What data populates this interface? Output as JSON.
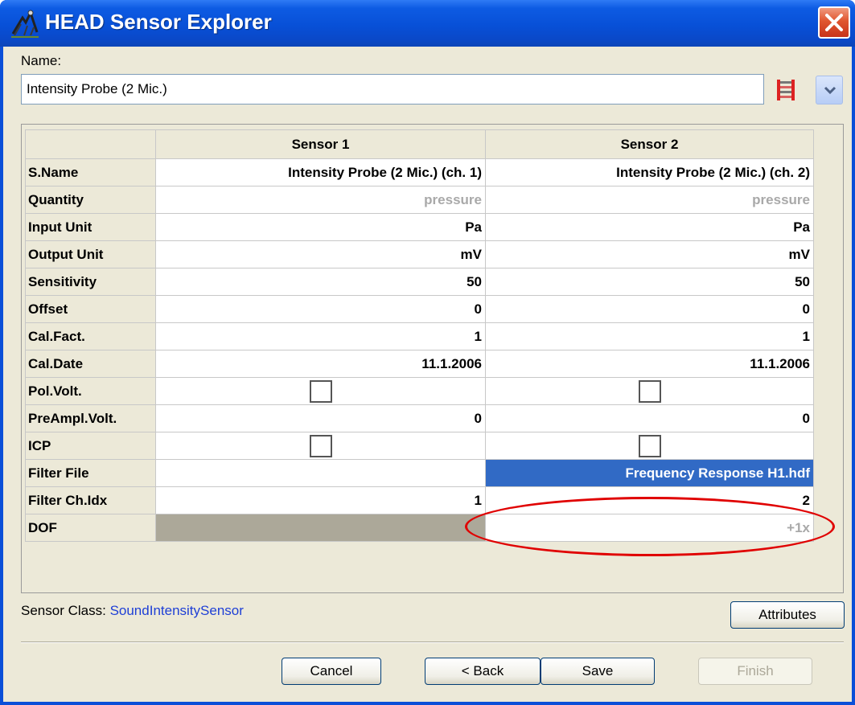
{
  "window": {
    "title": "HEAD Sensor Explorer",
    "app_icon": "head-explorer-icon",
    "close_icon": "close-icon"
  },
  "name_field": {
    "label": "Name:",
    "value": "Intensity Probe (2 Mic.)",
    "list_icon": "sensor-list-icon",
    "dropdown_icon": "chevron-down-icon"
  },
  "grid": {
    "columns": [
      "Sensor 1",
      "Sensor 2"
    ],
    "rows": [
      {
        "label": "S.Name",
        "s1": "Intensity Probe (2 Mic.) (ch. 1)",
        "s2": "Intensity Probe (2 Mic.) (ch. 2)"
      },
      {
        "label": "Quantity",
        "s1": "pressure",
        "s2": "pressure"
      },
      {
        "label": "Input Unit",
        "s1": "Pa",
        "s2": "Pa"
      },
      {
        "label": "Output Unit",
        "s1": "mV",
        "s2": "mV"
      },
      {
        "label": "Sensitivity",
        "s1": "50",
        "s2": "50"
      },
      {
        "label": "Offset",
        "s1": "0",
        "s2": "0"
      },
      {
        "label": "Cal.Fact.",
        "s1": "1",
        "s2": "1"
      },
      {
        "label": "Cal.Date",
        "s1": "11.1.2006",
        "s2": "11.1.2006"
      },
      {
        "label": "Pol.Volt.",
        "s1": false,
        "s2": false
      },
      {
        "label": "PreAmpl.Volt.",
        "s1": "0",
        "s2": "0"
      },
      {
        "label": "ICP",
        "s1": false,
        "s2": false
      },
      {
        "label": "Filter File",
        "s1": "",
        "s2": "Frequency Response H1.hdf"
      },
      {
        "label": "Filter Ch.Idx",
        "s1": "1",
        "s2": "2"
      },
      {
        "label": "DOF",
        "s1": "",
        "s2": "+1x"
      }
    ]
  },
  "sensor_class": {
    "label": "Sensor Class:",
    "value": "SoundIntensitySensor"
  },
  "buttons": {
    "attributes": "Attributes",
    "cancel": "Cancel",
    "back": "< Back",
    "save": "Save",
    "finish": "Finish"
  },
  "colors": {
    "selection": "#316ac5",
    "highlight_ring": "#e00000",
    "sensor_class_value": "#1e3fd6"
  }
}
